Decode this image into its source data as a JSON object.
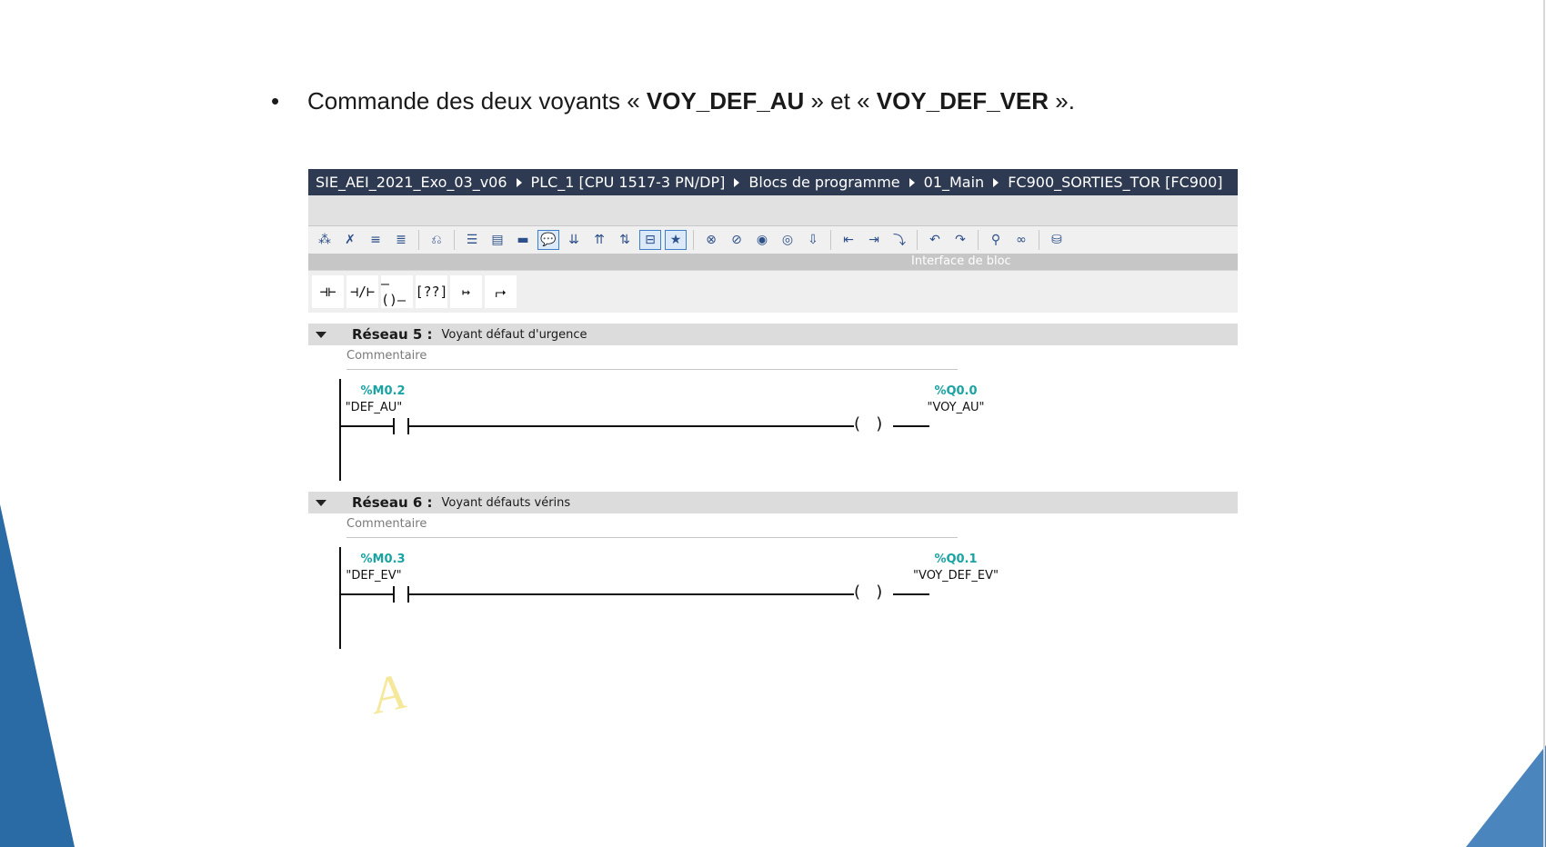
{
  "slide": {
    "bullet": "•",
    "text_before": "Commande des deux voyants « ",
    "bold1": "VOY_DEF_AU",
    "text_middle": " » et « ",
    "bold2": "VOY_DEF_VER",
    "text_after": " »."
  },
  "breadcrumb": [
    "SIE_AEI_2021_Exo_03_v06",
    "PLC_1 [CPU 1517-3 PN/DP]",
    "Blocs de programme",
    "01_Main",
    "FC900_SORTIES_TOR [FC900]"
  ],
  "interface_label": "Interface de bloc",
  "instructions": [
    "⊣⊢",
    "⊣/⊢",
    "–()–",
    "[??]",
    "↦",
    "⮣"
  ],
  "networks": [
    {
      "title": "Réseau 5 :",
      "description": "Voyant défaut d'urgence",
      "comment": "Commentaire",
      "contact_address": "%M0.2",
      "contact_tag": "\"DEF_AU\"",
      "coil_address": "%Q0.0",
      "coil_tag": "\"VOY_AU\""
    },
    {
      "title": "Réseau 6 :",
      "description": "Voyant défauts vérins",
      "comment": "Commentaire",
      "contact_address": "%M0.3",
      "contact_tag": "\"DEF_EV\"",
      "coil_address": "%Q0.1",
      "coil_tag": "\"VOY_DEF_EV\""
    }
  ],
  "colors": {
    "breadcrumb_bg": "#2e3a52",
    "address": "#1aa3a3",
    "deco_blue": "#2a6aa5"
  }
}
